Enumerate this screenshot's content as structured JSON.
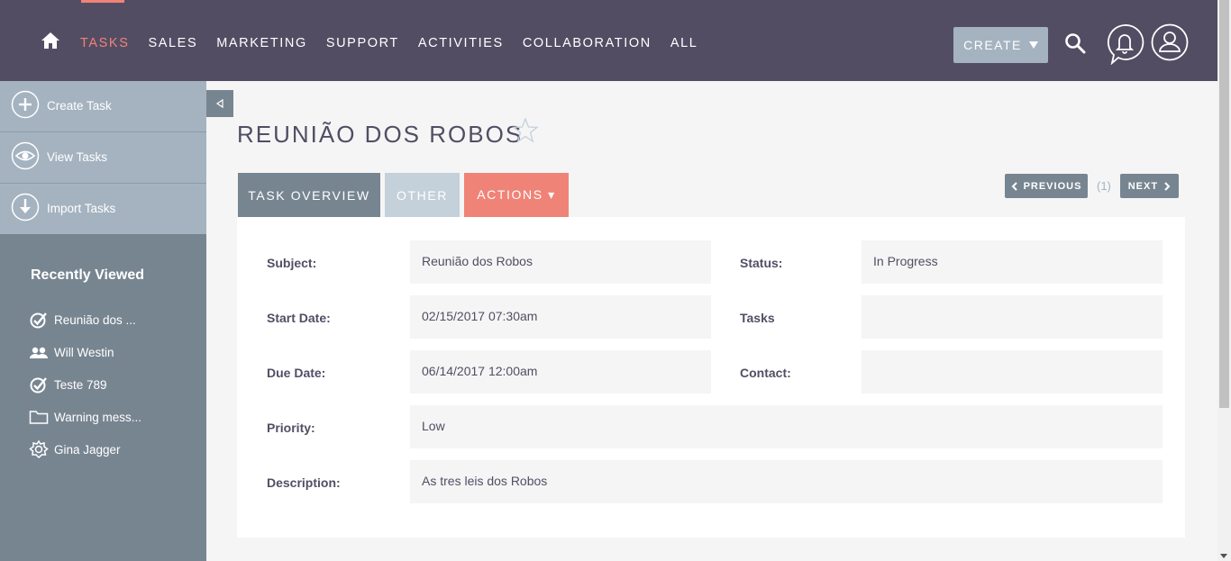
{
  "nav": {
    "items": [
      "TASKS",
      "SALES",
      "MARKETING",
      "SUPPORT",
      "ACTIVITIES",
      "COLLABORATION",
      "ALL"
    ],
    "active": "TASKS",
    "create_label": "CREATE"
  },
  "sidebar": {
    "actions": [
      {
        "label": "Create Task",
        "icon": "plus-circle-icon"
      },
      {
        "label": "View Tasks",
        "icon": "eye-icon"
      },
      {
        "label": "Import Tasks",
        "icon": "download-arrow-icon"
      }
    ],
    "recent_title": "Recently Viewed",
    "recent": [
      {
        "label": "Reunião dos ...",
        "icon": "task-check-icon"
      },
      {
        "label": "Will Westin",
        "icon": "contacts-icon"
      },
      {
        "label": "Teste 789",
        "icon": "task-check-icon"
      },
      {
        "label": "Warning mess...",
        "icon": "folder-icon"
      },
      {
        "label": "Gina Jagger",
        "icon": "gear-badge-icon"
      }
    ]
  },
  "page": {
    "title": "REUNIÃO DOS ROBOS"
  },
  "tabs": {
    "overview": "TASK OVERVIEW",
    "other": "OTHER",
    "actions": "ACTIONS ▾"
  },
  "pager": {
    "previous": "PREVIOUS",
    "count": "(1)",
    "next": "NEXT"
  },
  "fields": {
    "subject_label": "Subject:",
    "subject": "Reunião dos Robos",
    "status_label": "Status:",
    "status": "In Progress",
    "start_label": "Start Date:",
    "start": "02/15/2017 07:30am",
    "tasks_label": "Tasks",
    "tasks": "",
    "due_label": "Due Date:",
    "due": "06/14/2017 12:00am",
    "contact_label": "Contact:",
    "contact": "",
    "priority_label": "Priority:",
    "priority": "Low",
    "description_label": "Description:",
    "description": "As tres leis dos Robos"
  },
  "colors": {
    "header": "#534d64",
    "accent": "#f08377",
    "sidebar": "#778591",
    "sidebar_actions": "#a5b3c0"
  }
}
